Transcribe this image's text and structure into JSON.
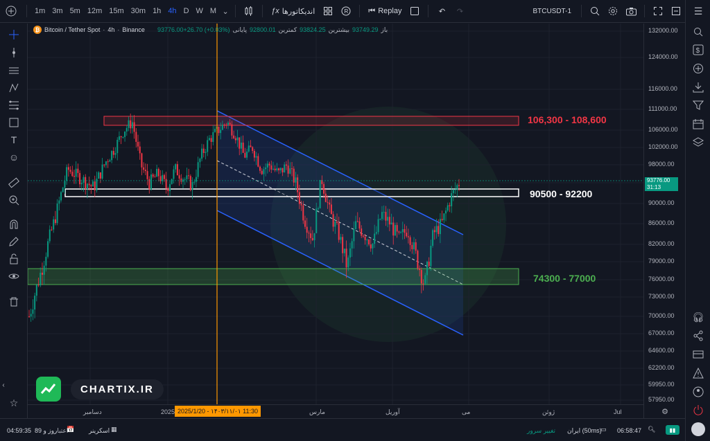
{
  "topbar": {
    "add_symbol": "+",
    "timeframes": [
      "1m",
      "3m",
      "5m",
      "12m",
      "15m",
      "30m",
      "1h",
      "4h",
      "D",
      "W",
      "M"
    ],
    "active_timeframe": "4h",
    "indicators_label": "اندیکاتورها",
    "replay_label": "Replay",
    "symbol_right": "BTCUSDT-1"
  },
  "legend": {
    "symbol": "Bitcoin / Tether Spot",
    "interval": "4h",
    "exchange": "Binance",
    "close_value": "93776.00+26.70 (+0.03%)",
    "close_label": "پایانی",
    "low_value": "92800.01",
    "low_label": "کمترین",
    "high_value": "93824.25",
    "high_label": "بیشترین",
    "open_value": "93749.29",
    "open_label": "باز"
  },
  "zones": {
    "red": "106,300 - 108,600",
    "white": "90500 - 92200",
    "green": "74300 - 77000"
  },
  "price_axis": [
    "132000.00",
    "124000.00",
    "116000.00",
    "111000.00",
    "106000.00",
    "102000.00",
    "98000.00",
    "94000.00",
    "90000.00",
    "86000.00",
    "82000.00",
    "79000.00",
    "76000.00",
    "73000.00",
    "70000.00",
    "67000.00",
    "64600.00",
    "62200.00",
    "59950.00",
    "57950.00"
  ],
  "current_price": {
    "price": "93776.00",
    "countdown": "31:13"
  },
  "time_axis": [
    "دسامبر",
    "2025",
    "مارس",
    "آوریل",
    "می",
    "ژوئن",
    "Jul"
  ],
  "crosshair_date": "2025/1/20 - ۱۴۰۳/۱۱/۰۱   11:30",
  "logo_text": "CHARTIX.IR",
  "bottombar": {
    "time_left": "04:59:35",
    "credit_text": "89 روز و",
    "credit_label": "اعتبار",
    "screener_label": "اسکرینر",
    "change_server": "تغییر سرور",
    "server": "ایران (50ms)",
    "time_right": "06:58:47"
  },
  "colors": {
    "bg": "#131722",
    "up": "#089981",
    "down": "#f23645",
    "red_zone": "#f23645",
    "green_zone": "#4caf50",
    "channel": "#2962ff",
    "crosshair": "#ff9800"
  },
  "chart_data": {
    "type": "candlestick",
    "symbol": "BTCUSDT",
    "interval": "4h",
    "last_price": 93776.0,
    "zones": [
      {
        "label": "106,300 - 108,600",
        "low": 106300,
        "high": 108600,
        "color": "red"
      },
      {
        "label": "90500 - 92200",
        "low": 90500,
        "high": 92200,
        "color": "white"
      },
      {
        "label": "74300 - 77000",
        "low": 74300,
        "high": 77000,
        "color": "green"
      }
    ],
    "path": [
      [
        0,
        70000
      ],
      [
        0.03,
        78000
      ],
      [
        0.06,
        87000
      ],
      [
        0.09,
        97000
      ],
      [
        0.12,
        95000
      ],
      [
        0.15,
        93000
      ],
      [
        0.18,
        99000
      ],
      [
        0.2,
        102000
      ],
      [
        0.22,
        106000
      ],
      [
        0.24,
        108000
      ],
      [
        0.26,
        98000
      ],
      [
        0.28,
        94000
      ],
      [
        0.3,
        96000
      ],
      [
        0.32,
        93000
      ],
      [
        0.34,
        97000
      ],
      [
        0.36,
        95000
      ],
      [
        0.38,
        93500
      ],
      [
        0.4,
        100000
      ],
      [
        0.42,
        104000
      ],
      [
        0.44,
        106000
      ],
      [
        0.46,
        108000
      ],
      [
        0.48,
        105000
      ],
      [
        0.5,
        100000
      ],
      [
        0.52,
        102000
      ],
      [
        0.54,
        97000
      ],
      [
        0.56,
        98000
      ],
      [
        0.58,
        96000
      ],
      [
        0.6,
        98000
      ],
      [
        0.62,
        94000
      ],
      [
        0.64,
        87000
      ],
      [
        0.66,
        83000
      ],
      [
        0.68,
        95000
      ],
      [
        0.7,
        88000
      ],
      [
        0.72,
        84000
      ],
      [
        0.74,
        78000
      ],
      [
        0.76,
        86000
      ],
      [
        0.78,
        84000
      ],
      [
        0.8,
        82000
      ],
      [
        0.82,
        88000
      ],
      [
        0.84,
        86000
      ],
      [
        0.86,
        83000
      ],
      [
        0.88,
        85000
      ],
      [
        0.9,
        80000
      ],
      [
        0.92,
        75000
      ],
      [
        0.94,
        84000
      ],
      [
        0.96,
        86000
      ],
      [
        0.98,
        91000
      ],
      [
        1.0,
        94000
      ]
    ]
  }
}
